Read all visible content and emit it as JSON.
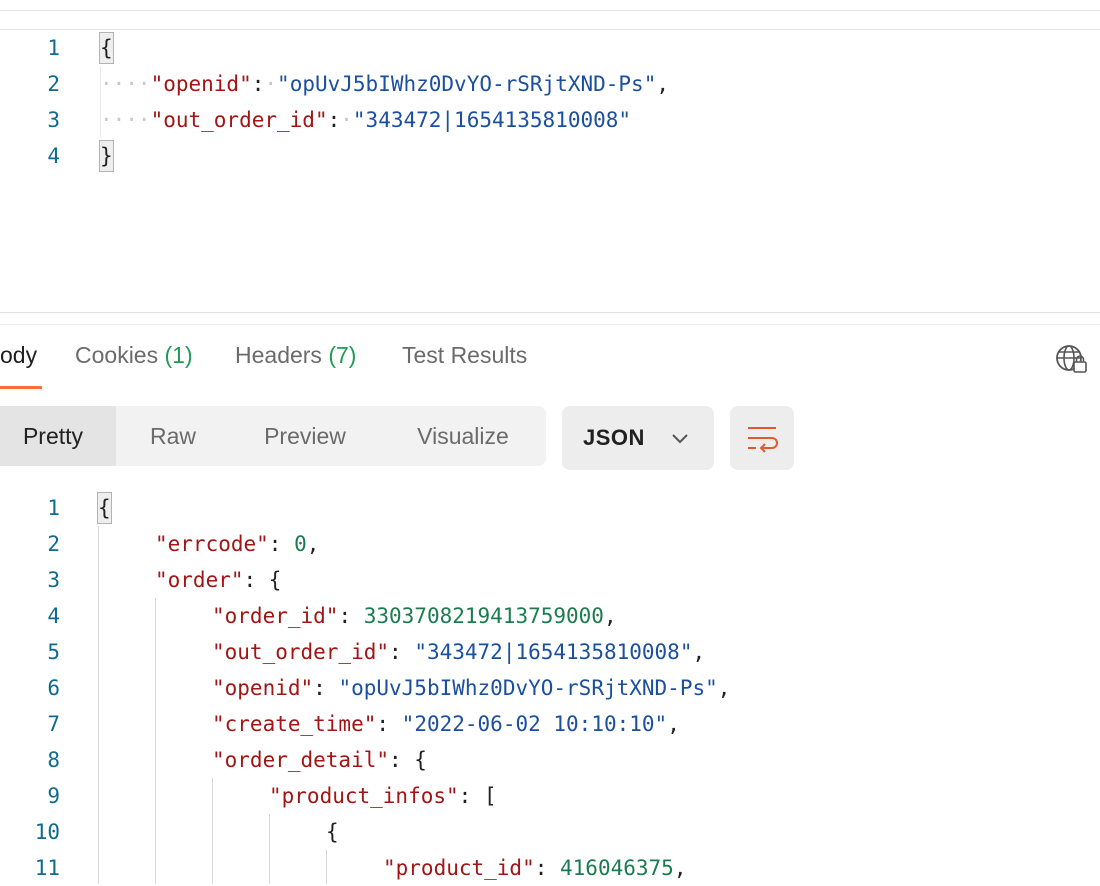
{
  "request_body": {
    "lines": [
      {
        "num": "1",
        "text": "{"
      },
      {
        "num": "2",
        "dots": "····",
        "key": "\"openid\"",
        "sep": ":",
        "dot2": "·",
        "value": "\"opUvJ5bIWhz0DvYO-rSRjtXND-Ps\"",
        "tail": ","
      },
      {
        "num": "3",
        "dots": "····",
        "key": "\"out_order_id\"",
        "sep": ":",
        "dot2": "·",
        "value": "\"343472|1654135810008\"",
        "tail": ""
      },
      {
        "num": "4",
        "text": "}"
      }
    ]
  },
  "response_tabs": {
    "body_label": "ody",
    "cookies_label": "Cookies",
    "cookies_count": "(1)",
    "headers_label": "Headers",
    "headers_count": "(7)",
    "tests_label": "Test Results"
  },
  "view_modes": {
    "pretty": "Pretty",
    "raw": "Raw",
    "preview": "Preview",
    "visualize": "Visualize",
    "active": "Pretty"
  },
  "format_select": {
    "value": "JSON"
  },
  "icons": {
    "globe": "globe-lock-icon",
    "wrap": "text-wrap-icon",
    "chevron": "chevron-down-icon"
  },
  "colors": {
    "accent": "#ff6c37",
    "key": "#a31515",
    "string": "#1b4fa0",
    "number": "#1b7c4f",
    "line_number": "#0e6a90"
  },
  "response_body": {
    "line_numbers": [
      "1",
      "2",
      "3",
      "4",
      "5",
      "6",
      "7",
      "8",
      "9",
      "10",
      "11"
    ],
    "l1": "{",
    "l2_key": "\"errcode\"",
    "l2_sep": ": ",
    "l2_val": "0",
    "l2_tail": ",",
    "l3_key": "\"order\"",
    "l3_tail": ": {",
    "l4_key": "\"order_id\"",
    "l4_sep": ": ",
    "l4_val": "3303708219413759000",
    "l4_tail": ",",
    "l5_key": "\"out_order_id\"",
    "l5_sep": ": ",
    "l5_val": "\"343472|1654135810008\"",
    "l5_tail": ",",
    "l6_key": "\"openid\"",
    "l6_sep": ": ",
    "l6_val": "\"opUvJ5bIWhz0DvYO-rSRjtXND-Ps\"",
    "l6_tail": ",",
    "l7_key": "\"create_time\"",
    "l7_sep": ": ",
    "l7_val": "\"2022-06-02 10:10:10\"",
    "l7_tail": ",",
    "l8_key": "\"order_detail\"",
    "l8_tail": ": {",
    "l9_key": "\"product_infos\"",
    "l9_tail": ": [",
    "l10": "{",
    "l11_key": "\"product_id\"",
    "l11_sep": ": ",
    "l11_val": "416046375",
    "l11_tail": ","
  }
}
